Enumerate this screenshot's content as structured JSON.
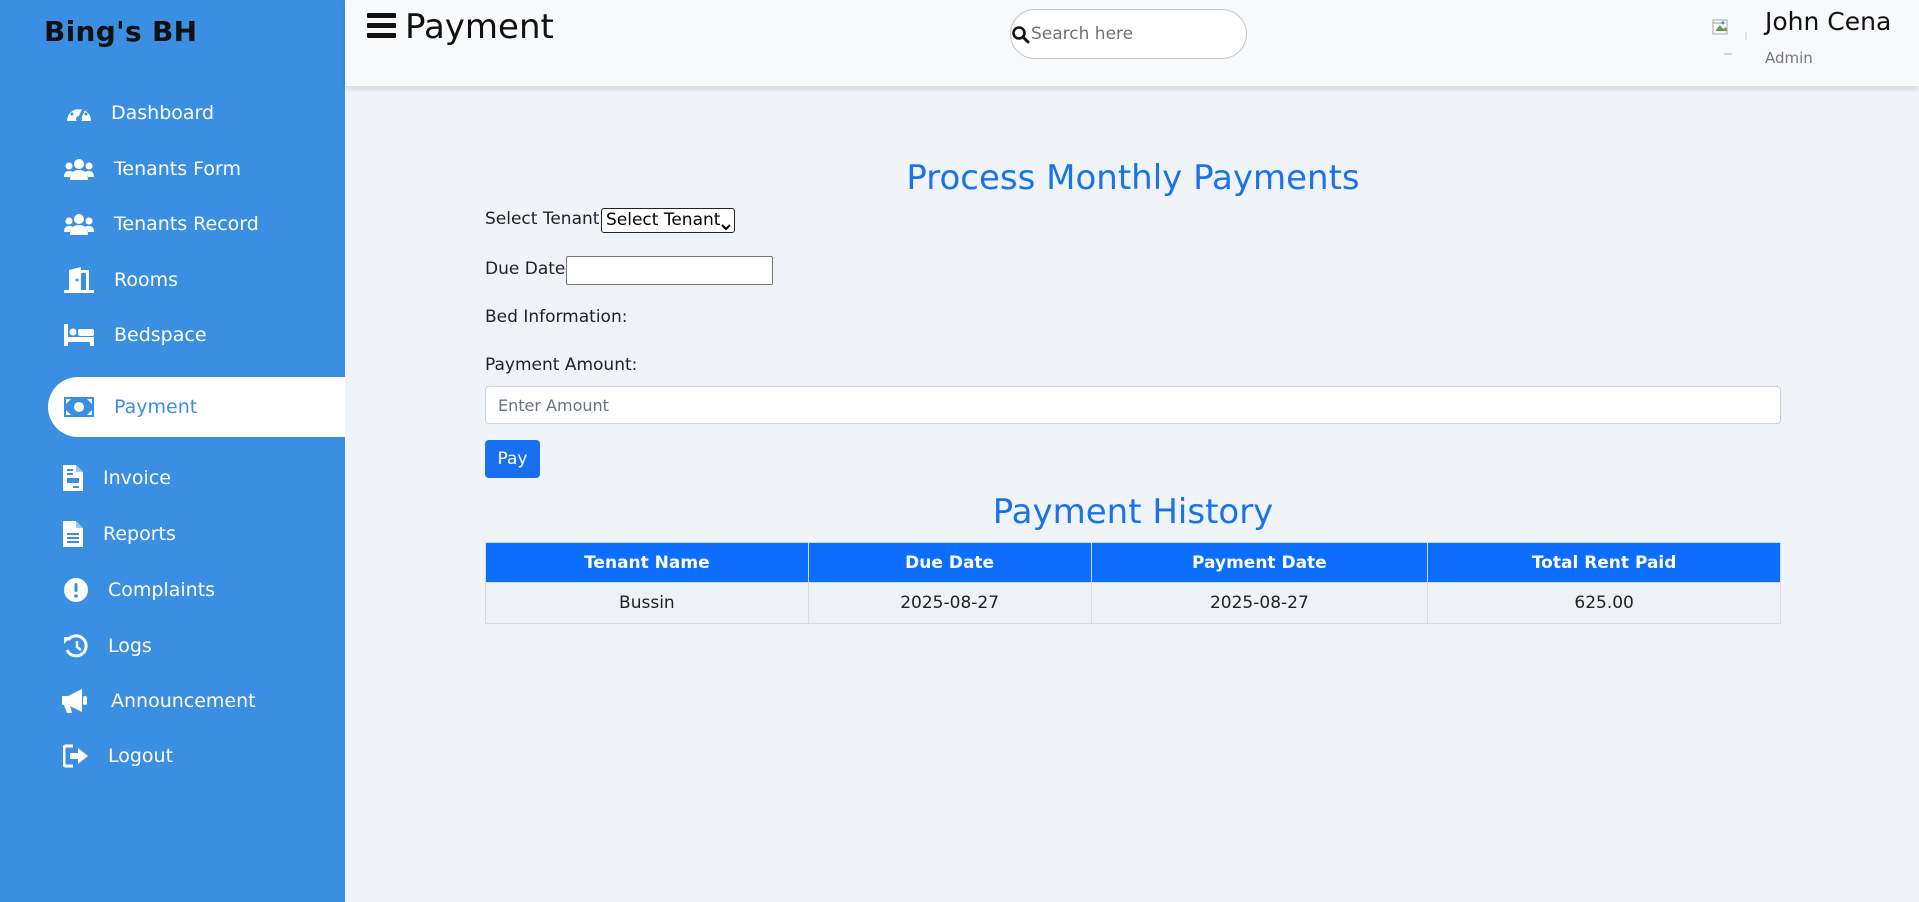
{
  "sidebar": {
    "brand": "Bing's BH",
    "items": [
      {
        "label": "Dashboard",
        "icon": "gauge-icon"
      },
      {
        "label": "Tenants Form",
        "icon": "users-icon"
      },
      {
        "label": "Tenants Record",
        "icon": "users-icon"
      },
      {
        "label": "Rooms",
        "icon": "door-icon"
      },
      {
        "label": "Bedspace",
        "icon": "bed-icon"
      },
      {
        "label": "Payment",
        "icon": "money-icon",
        "active": true
      },
      {
        "label": "Invoice",
        "icon": "file-invoice-icon"
      },
      {
        "label": "Reports",
        "icon": "file-icon"
      },
      {
        "label": "Complaints",
        "icon": "exclamation-icon"
      },
      {
        "label": "Logs",
        "icon": "history-icon"
      },
      {
        "label": "Announcement",
        "icon": "megaphone-icon"
      },
      {
        "label": "Logout",
        "icon": "logout-icon"
      }
    ]
  },
  "header": {
    "title": "Payment",
    "search_placeholder": "Search here",
    "user_name": "John Cena",
    "user_role": "Admin"
  },
  "form": {
    "heading": "Process Monthly Payments",
    "select_tenant_label": "Select Tenant:",
    "select_tenant_value": "Select Tenant",
    "due_date_label": "Due Date:",
    "due_date_value": "",
    "bed_info_label": "Bed Information:",
    "payment_amount_label": "Payment Amount:",
    "amount_placeholder": "Enter Amount",
    "pay_label": "Pay"
  },
  "history": {
    "heading": "Payment History",
    "columns": [
      "Tenant Name",
      "Due Date",
      "Payment Date",
      "Total Rent Paid"
    ],
    "rows": [
      [
        "Bussin",
        "2025-08-27",
        "2025-08-27",
        "625.00"
      ]
    ]
  },
  "colors": {
    "sidebar": "#3b8fe2",
    "accent": "#1a73e8",
    "button": "#1a6ff0",
    "table_header": "#0d6efd"
  }
}
